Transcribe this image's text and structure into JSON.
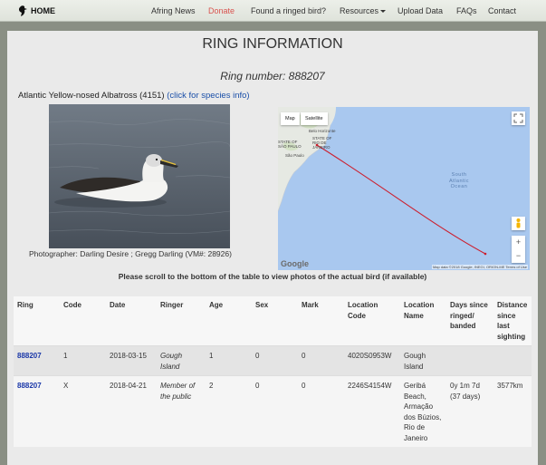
{
  "nav": {
    "home": "HOME",
    "items": [
      {
        "label": "Afring News"
      },
      {
        "label": "Donate"
      },
      {
        "label": "Found a ringed bird?"
      },
      {
        "label": "Resources"
      },
      {
        "label": "Upload Data"
      },
      {
        "label": "FAQs"
      },
      {
        "label": "Contact"
      }
    ]
  },
  "page": {
    "title": "RING INFORMATION",
    "ring_number": "Ring number: 888207",
    "species_text": "Atlantic Yellow-nosed Albatross (4151) ",
    "species_link": "(click for species info)",
    "photo_caption": "Photographer: Darling Desire ; Gregg Darling (VM#: 28926)",
    "notice": "Please scroll to the bottom of the table to view photos of the actual bird (if available)"
  },
  "map": {
    "btn_map": "Map",
    "btn_satellite": "Satellite",
    "ocean_label": "South Atlantic Ocean",
    "ocean_line1": "South",
    "ocean_line2": "Atlantic",
    "ocean_line3": "Ocean",
    "city_bh": "Belo Horizonte",
    "city_rio": "STATE OF RIO DE JANEIRO",
    "city_sp": "São Paulo",
    "state_sp": "STATE OF SÃO PAULO",
    "google": "Google",
    "attribution": "Map data ©2018 Google, INEGI, ORION-ME   Terms of Use",
    "zoom_in": "+",
    "zoom_out": "−",
    "colors": {
      "ocean": "#a9c8ef",
      "land": "#e6e9e3",
      "track": "#cc1f2e"
    }
  },
  "table": {
    "headers": [
      "Ring",
      "Code",
      "Date",
      "Ringer",
      "Age",
      "Sex",
      "Mark",
      "Location Code",
      "Location Name",
      "Days since ringed/ banded",
      "Distance since last sighting"
    ],
    "rows": [
      {
        "ring": "888207",
        "code": "1",
        "date": "2018-03-15",
        "ringer": "Gough Island",
        "age": "1",
        "sex": "0",
        "mark": "0",
        "loc_code": "4020S0953W",
        "loc_name": "Gough Island",
        "days": "",
        "distance": ""
      },
      {
        "ring": "888207",
        "code": "X",
        "date": "2018-04-21",
        "ringer": "Member of the public",
        "age": "2",
        "sex": "0",
        "mark": "0",
        "loc_code": "2246S4154W",
        "loc_name": "Geribá Beach, Armação dos Búzios, Rio de Janeiro",
        "days": "0y 1m 7d (37 days)",
        "distance": "3577km"
      }
    ]
  }
}
